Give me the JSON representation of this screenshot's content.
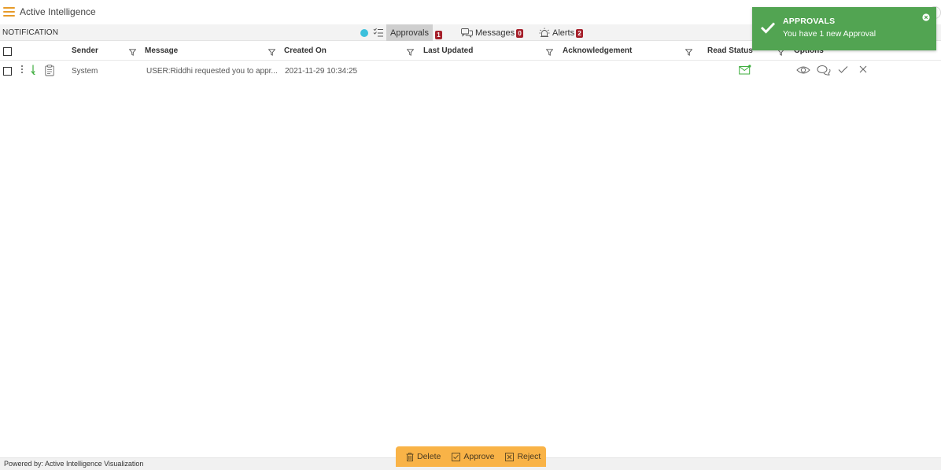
{
  "app": {
    "title": "Active Intelligence"
  },
  "tabbar": {
    "section_label": "NOTIFICATION",
    "tabs": [
      {
        "label": "Approvals",
        "badge": "1",
        "icon": "list-check-icon",
        "active": true
      },
      {
        "label": "Messages",
        "badge": "0",
        "icon": "chat-bubbles-icon",
        "active": false
      },
      {
        "label": "Alerts",
        "badge": "2",
        "icon": "alarm-icon",
        "active": false
      }
    ]
  },
  "table": {
    "columns": [
      "Sender",
      "Message",
      "Created On",
      "Last Updated",
      "Acknowledgement",
      "Read Status",
      "Options"
    ],
    "rows": [
      {
        "sender": "System",
        "message": "USER:Riddhi requested you to appr...",
        "created_on": "2021-11-29 10:34:25",
        "last_updated": "",
        "acknowledgement": "",
        "read_status": "read-envelope-icon",
        "options": [
          "eye-icon",
          "comment-icon",
          "approve-check-icon",
          "reject-x-icon"
        ]
      }
    ]
  },
  "toast": {
    "title": "APPROVALS",
    "message": "You have 1 new Approval",
    "color": "#52a452"
  },
  "actions": {
    "delete_label": "Delete",
    "approve_label": "Approve",
    "reject_label": "Reject"
  },
  "footer": {
    "text": "Powered by: Active Intelligence Visualization"
  },
  "colors": {
    "accent": "#f9b347",
    "badge": "#a51f2a",
    "success": "#52a452",
    "status_dot": "#3cc0dc"
  }
}
